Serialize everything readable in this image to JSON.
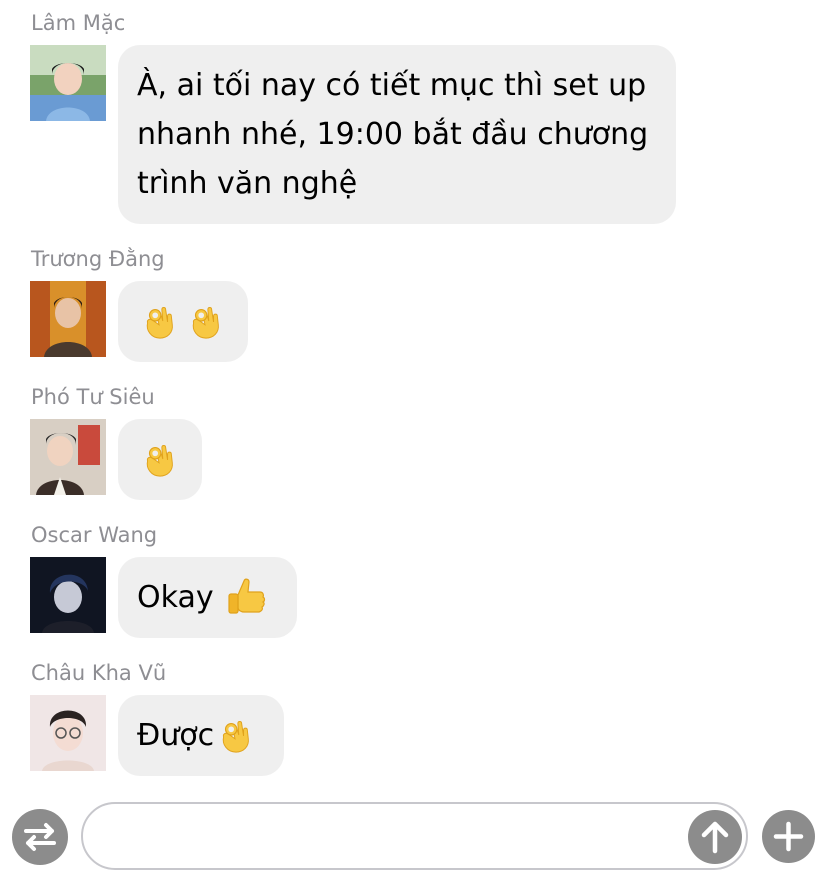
{
  "messages": [
    {
      "sender": "Lâm Mặc",
      "lines": [
        "À, ai tối nay có tiết mục thì set up",
        "nhanh nhé, 19:00 bắt đầu chương",
        "trình văn nghệ"
      ]
    },
    {
      "sender": "Trương Đằng",
      "emojis": [
        "ok-hand-emoji",
        "ok-hand-emoji"
      ]
    },
    {
      "sender": "Phó Tư Siêu",
      "emojis": [
        "ok-hand-emoji"
      ]
    },
    {
      "sender": "Oscar Wang",
      "text": "Okay",
      "emojis": [
        "thumbs-up-emoji"
      ]
    },
    {
      "sender": "Châu Kha Vũ",
      "text": "Được",
      "emojis": [
        "ok-hand-emoji"
      ]
    }
  ],
  "input_bar": {
    "value": "",
    "left_button_icon": "swap-arrows-icon",
    "send_icon": "arrow-up-icon",
    "add_icon": "plus-icon"
  },
  "colors": {
    "bubble": "#efefef",
    "sender_name": "#8e8e93",
    "icon_button": "#8c8c8c",
    "emoji_yellow": "#f7c843"
  }
}
